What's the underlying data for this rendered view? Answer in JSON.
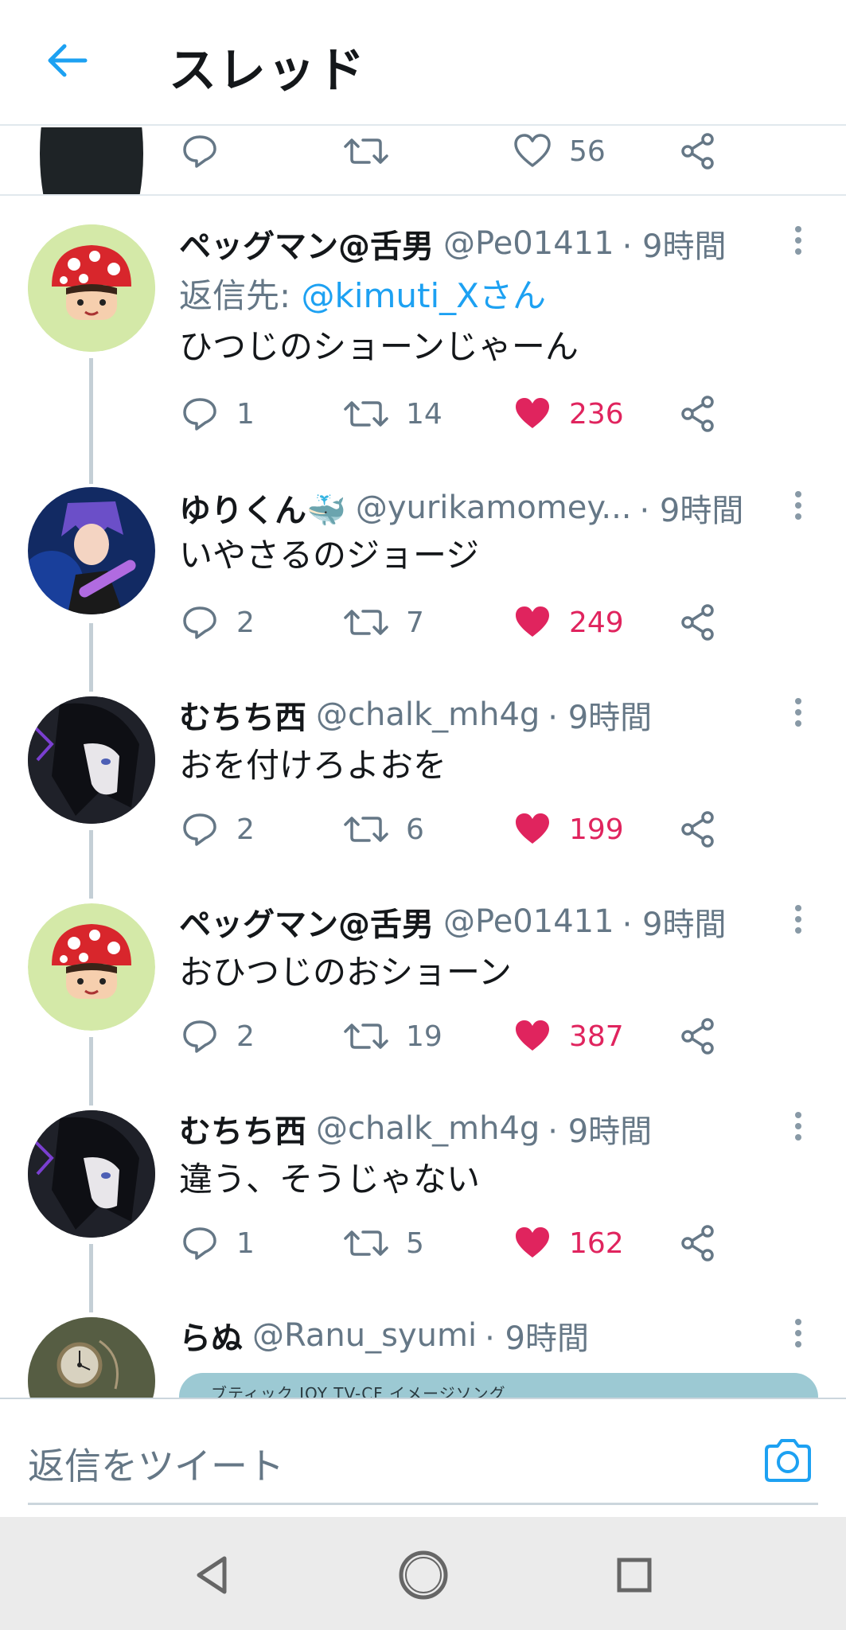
{
  "header": {
    "title": "スレッド"
  },
  "previous_tweet": {
    "like_count": "56"
  },
  "tweets": [
    {
      "name": "ペッグマン@舌男",
      "handle": "@Pe01411",
      "time": "· 9時間",
      "reply_to_prefix": "返信先: ",
      "reply_to_user": "@kimuti_Xさん",
      "text": "ひつじのショーンじゃーん",
      "replies": "1",
      "retweets": "14",
      "likes": "236"
    },
    {
      "name": "ゆりくん🐳",
      "handle": "@yurikamomey...",
      "time": " · 9時間",
      "text": "いやさるのジョージ",
      "replies": "2",
      "retweets": "7",
      "likes": "249"
    },
    {
      "name": "むちち西",
      "handle": "@chalk_mh4g",
      "time": "· 9時間",
      "text": "おを付けろよおを",
      "replies": "2",
      "retweets": "6",
      "likes": "199"
    },
    {
      "name": "ペッグマン@舌男",
      "handle": "@Pe01411",
      "time": "· 9時間",
      "text": "おひつじのおショーン",
      "replies": "2",
      "retweets": "19",
      "likes": "387"
    },
    {
      "name": "むちち西",
      "handle": "@chalk_mh4g",
      "time": "· 9時間",
      "text": "違う、そうじゃない",
      "replies": "1",
      "retweets": "5",
      "likes": "162"
    },
    {
      "name": "らぬ",
      "handle": "@Ranu_syumi",
      "time": "· 9時間",
      "media_caption": "ブティック JOY TV-CF イメージソング"
    }
  ],
  "composer": {
    "placeholder": "返信をツイート"
  },
  "colors": {
    "accent": "#1da1f2",
    "like": "#e0245e",
    "secondary": "#657786"
  },
  "icons": [
    "back-arrow-icon",
    "reply-icon",
    "retweet-icon",
    "heart-icon",
    "share-icon",
    "more-icon",
    "camera-icon",
    "nav-back-icon",
    "nav-home-icon",
    "nav-recents-icon"
  ]
}
